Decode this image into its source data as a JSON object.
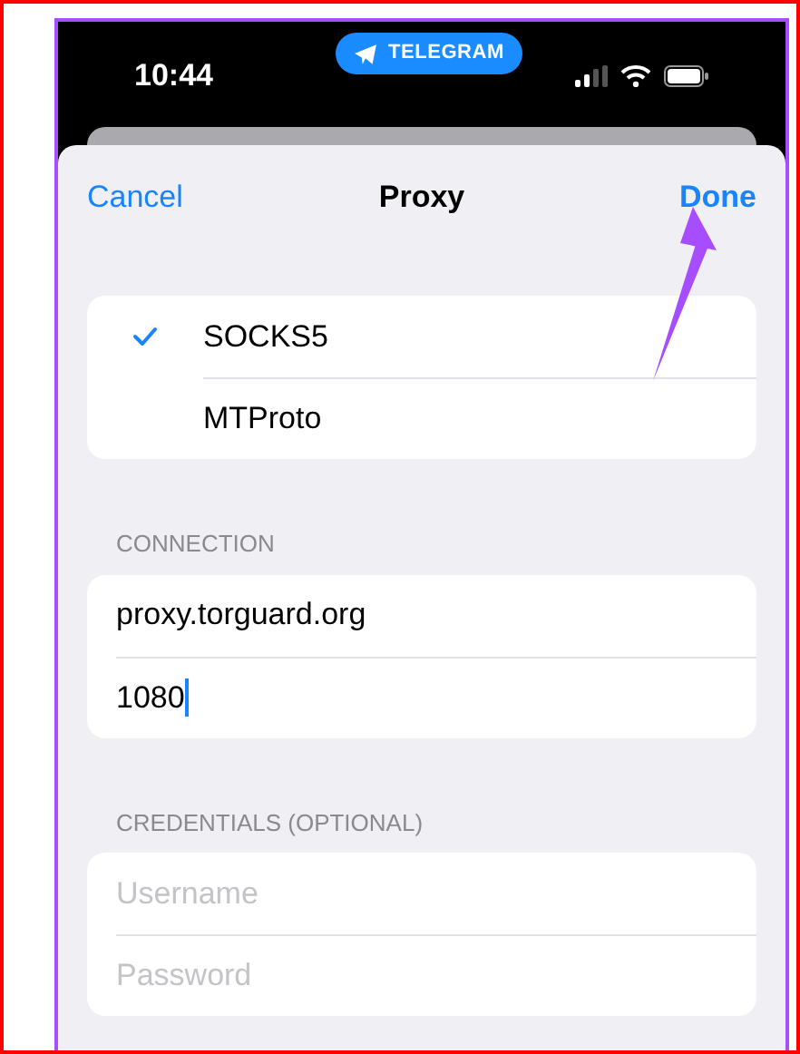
{
  "status_bar": {
    "time": "10:44",
    "app_pill": "TELEGRAM"
  },
  "nav": {
    "cancel": "Cancel",
    "title": "Proxy",
    "done": "Done"
  },
  "proxy_types": [
    {
      "label": "SOCKS5",
      "selected": true
    },
    {
      "label": "MTProto",
      "selected": false
    }
  ],
  "sections": [
    {
      "header": "CONNECTION",
      "fields": [
        {
          "value": "proxy.torguard.org",
          "focused": false
        },
        {
          "value": "1080",
          "focused": true
        }
      ]
    },
    {
      "header": "CREDENTIALS (OPTIONAL)",
      "fields": [
        {
          "placeholder": "Username"
        },
        {
          "placeholder": "Password"
        }
      ]
    }
  ]
}
